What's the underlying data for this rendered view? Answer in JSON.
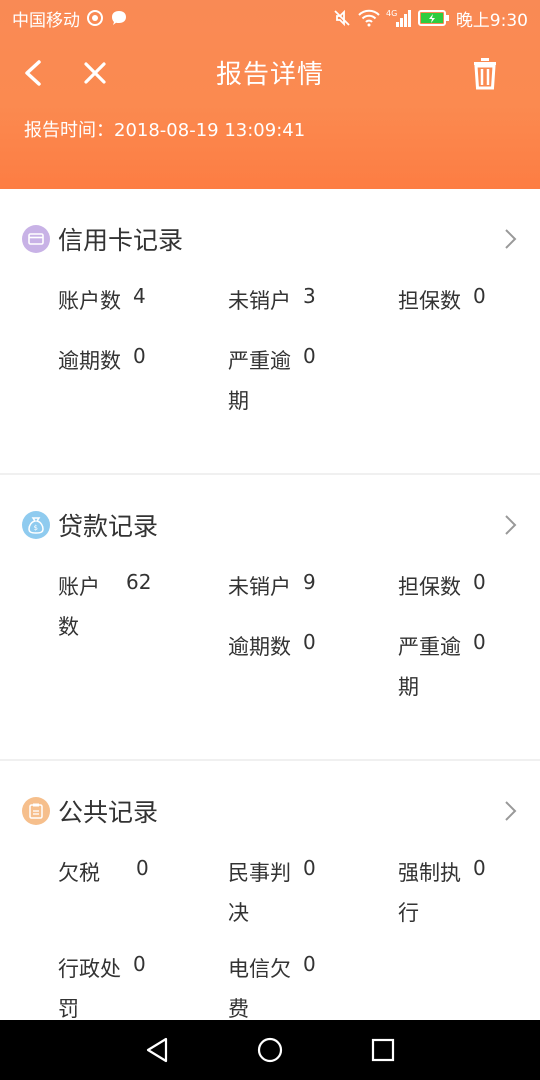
{
  "status": {
    "carrier": "中国移动",
    "time": "晚上9:30",
    "network": "4G"
  },
  "appbar": {
    "title": "报告详情"
  },
  "report_time": "报告时间：2018-08-19 13:09:41",
  "sections": [
    {
      "title": "信用卡记录",
      "icon": "credit-card-icon",
      "color": "#c8b2e6",
      "items": [
        {
          "label": "账户数",
          "value": "4"
        },
        {
          "label": "未销户",
          "value": "3"
        },
        {
          "label": "担保数",
          "value": "0"
        },
        {
          "label": "逾期数",
          "value": "0"
        },
        {
          "label": "严重逾",
          "label2": "期",
          "value": "0"
        }
      ]
    },
    {
      "title": "贷款记录",
      "icon": "money-bag-icon",
      "color": "#8fcbef",
      "items": [
        {
          "label": "账户",
          "label2": "数",
          "value": "62"
        },
        {
          "label": "未销户",
          "value": "9"
        },
        {
          "label": "担保数",
          "value": "0"
        },
        {
          "label": "逾期数",
          "value": "0"
        },
        {
          "label": "严重逾",
          "label2": "期",
          "value": "0"
        }
      ]
    },
    {
      "title": "公共记录",
      "icon": "clipboard-icon",
      "color": "#f6bf8c",
      "items": [
        {
          "label": "欠税",
          "value": "0"
        },
        {
          "label": "民事判",
          "label2": "决",
          "value": "0"
        },
        {
          "label": "强制执",
          "label2": "行",
          "value": "0"
        },
        {
          "label": "行政处",
          "label2": "罚",
          "value": "0"
        },
        {
          "label": "电信欠",
          "label2": "费",
          "value": "0"
        }
      ]
    }
  ]
}
